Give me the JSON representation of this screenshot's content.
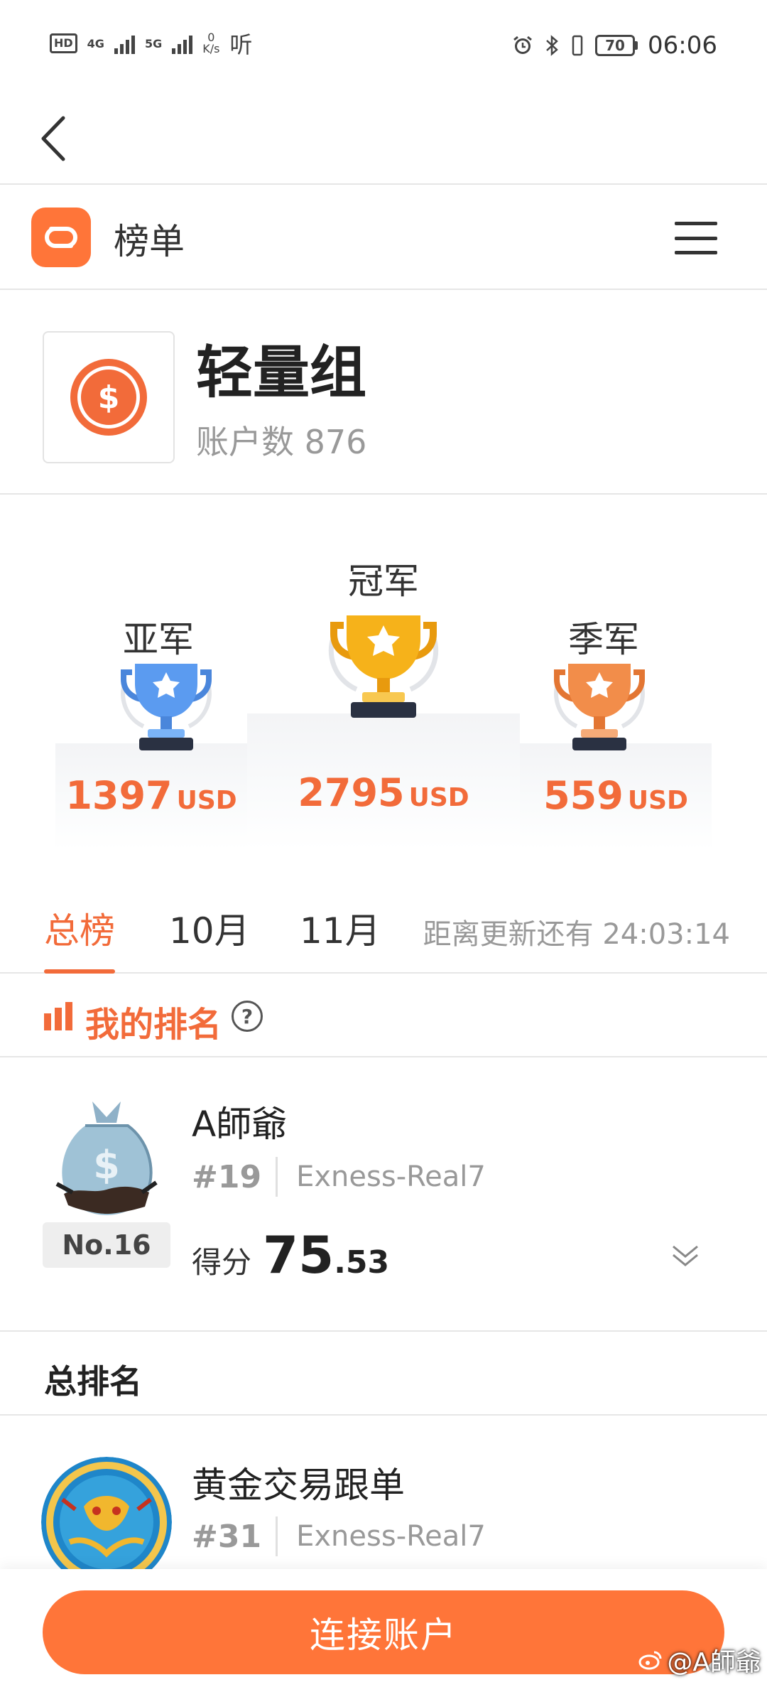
{
  "status_bar": {
    "hd": "HD",
    "net1": "4G",
    "net2": "5G",
    "speed_value": "0",
    "speed_unit": "K/s",
    "app_glyph": "听",
    "battery": "70",
    "time": "06:06",
    "icons": [
      "alarm-icon",
      "bluetooth-icon",
      "vibrate-icon",
      "battery-icon"
    ]
  },
  "nav": {
    "back_icon": "chevron-left-icon"
  },
  "header": {
    "title": "榜单",
    "logo_icon": "link-logo-icon",
    "menu_icon": "hamburger-menu-icon"
  },
  "group": {
    "name": "轻量组",
    "account_count_label": "账户数 876",
    "icon": "dollar-coin-icon"
  },
  "podium": {
    "second": {
      "label": "亚军",
      "amount": "1397",
      "currency": "USD",
      "trophy_color": "#5b9bf0"
    },
    "first": {
      "label": "冠军",
      "amount": "2795",
      "currency": "USD",
      "trophy_color": "#f6b21a"
    },
    "third": {
      "label": "季军",
      "amount": "559",
      "currency": "USD",
      "trophy_color": "#f28d4a"
    }
  },
  "tabs": {
    "items": [
      {
        "label": "总榜",
        "active": true
      },
      {
        "label": "10月",
        "active": false
      },
      {
        "label": "11月",
        "active": false
      }
    ],
    "countdown": "距离更新还有 24:03:14"
  },
  "my_ranking": {
    "title": "我的排名",
    "help_glyph": "?",
    "name": "A師爺",
    "badge": "No.16",
    "rank": "#19",
    "server": "Exness-Real7",
    "score_label": "得分",
    "score_int": "75",
    "score_dec": ".53"
  },
  "overall": {
    "title": "总排名",
    "items": [
      {
        "name": "黄金交易跟单",
        "rank": "#31",
        "server": "Exness-Real7"
      }
    ]
  },
  "bottom": {
    "connect_label": "连接账户"
  },
  "watermark": {
    "text": "@A師爺"
  },
  "colors": {
    "accent": "#f26b3a",
    "button": "#ff7539",
    "muted": "#999999"
  }
}
